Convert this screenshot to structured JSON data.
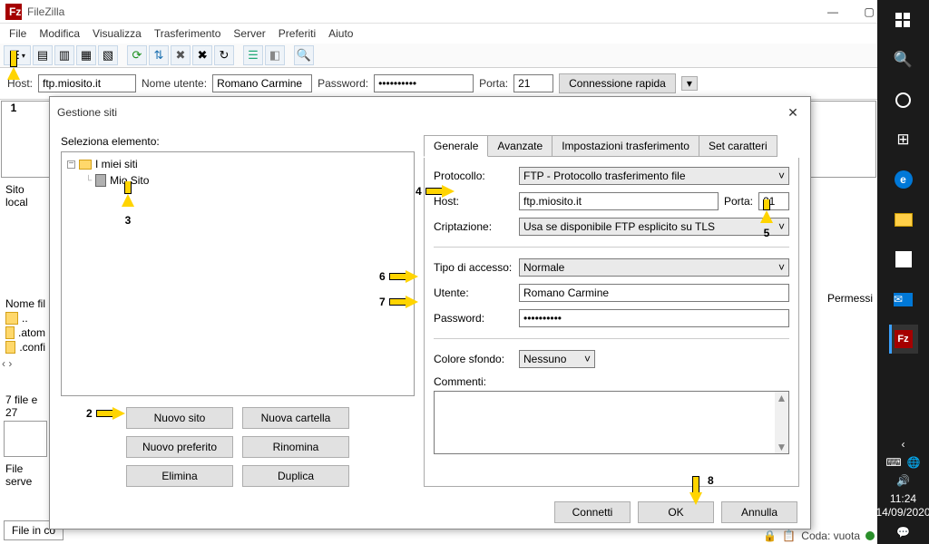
{
  "window": {
    "title": "FileZilla"
  },
  "menu": {
    "items": [
      "File",
      "Modifica",
      "Visualizza",
      "Trasferimento",
      "Server",
      "Preferiti",
      "Aiuto"
    ]
  },
  "quickconnect": {
    "host_label": "Host:",
    "host_value": "ftp.miosito.it",
    "user_label": "Nome utente:",
    "user_value": "Romano Carmine",
    "pass_label": "Password:",
    "pass_value": "••••••••••",
    "port_label": "Porta:",
    "port_value": "21",
    "connect_label": "Connessione rapida"
  },
  "back": {
    "local_site_label": "Sito local",
    "name_col": "Nome fil",
    "items": [
      "..",
      ".atom",
      ".confi"
    ],
    "summary": "7 file e 27",
    "file_server_label": "File serve",
    "perm_header": "Permessi",
    "bottom_tab": "File in co",
    "queue_label": "Coda: vuota"
  },
  "modal": {
    "title": "Gestione siti",
    "select_label": "Seleziona elemento:",
    "tree_root": "I miei siti",
    "tree_item": "Mio Sito",
    "buttons": {
      "new_site": "Nuovo sito",
      "new_folder": "Nuova cartella",
      "new_fav": "Nuovo preferito",
      "rename": "Rinomina",
      "delete": "Elimina",
      "duplicate": "Duplica"
    },
    "tabs": [
      "Generale",
      "Avanzate",
      "Impostazioni trasferimento",
      "Set caratteri"
    ],
    "form": {
      "protocol_label": "Protocollo:",
      "protocol_value": "FTP - Protocollo trasferimento file",
      "host_label": "Host:",
      "host_value": "ftp.miosito.it",
      "port_label": "Porta:",
      "port_value": "21",
      "encrypt_label": "Criptazione:",
      "encrypt_value": "Usa se disponibile FTP esplicito su TLS",
      "access_label": "Tipo di accesso:",
      "access_value": "Normale",
      "user_label": "Utente:",
      "user_value": "Romano Carmine",
      "pass_label": "Password:",
      "pass_value": "••••••••••",
      "bgcolor_label": "Colore sfondo:",
      "bgcolor_value": "Nessuno",
      "comments_label": "Commenti:"
    },
    "footer": {
      "connect": "Connetti",
      "ok": "OK",
      "cancel": "Annulla"
    }
  },
  "annotations": {
    "1": "1",
    "2": "2",
    "3": "3",
    "4": "4",
    "5": "5",
    "6": "6",
    "7": "7",
    "8": "8"
  },
  "taskbar": {
    "time": "11:24",
    "date": "14/09/2020"
  }
}
